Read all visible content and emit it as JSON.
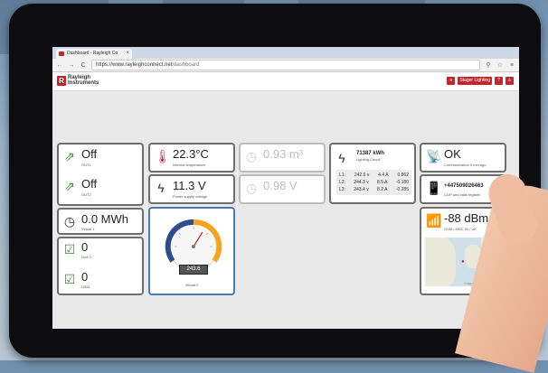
{
  "browser": {
    "tab_title": "Dashboard - Rayleigh Co",
    "tab_close": "×",
    "url_prefix": "https://www.rayleighconnect.net",
    "url_path": "/dashboard"
  },
  "header": {
    "logo_mark": "R",
    "logo_line1": "Rayleigh",
    "logo_line2": "Instruments",
    "buttons": [
      "≡",
      "Stager Lighting",
      "?",
      "⚠"
    ]
  },
  "tiles": {
    "out1": {
      "value": "Off",
      "label": "OUT1"
    },
    "out2": {
      "value": "Off",
      "label": "OUT2"
    },
    "temp": {
      "value": "22.3°C",
      "label": "Internal temperature"
    },
    "voltage": {
      "value": "11.3 V",
      "label": "Power supply voltage"
    },
    "flow": {
      "value": "0.93 m³",
      "label": ""
    },
    "volt2": {
      "value": "0.98 V",
      "label": ""
    },
    "virtual1": {
      "value": "0.0 MWh",
      "label": "Virtual 1"
    },
    "line2": {
      "value": "0",
      "label": "Line 2"
    },
    "din3": {
      "value": "0",
      "label": "DIN3"
    },
    "comm": {
      "value": "OK",
      "label": "Communication 5 min ago"
    },
    "phone": {
      "value": "+447509026463",
      "label": "CLIP and calls register"
    },
    "signal": {
      "value": "-88 dBm",
      "label": "GSM / MNC 50 / UK"
    }
  },
  "energy": {
    "value": "71387 kWh",
    "label": "Lighting Circuit",
    "rows": [
      {
        "line": "L1:",
        "volts": "242.6 v",
        "amps": "4.4 A",
        "pf": "0.862"
      },
      {
        "line": "L2:",
        "volts": "244.3 v",
        "amps": "8.5 A",
        "pf": "-0.180"
      },
      {
        "line": "L3:",
        "volts": "243.4 v",
        "amps": "8.2 A",
        "pf": "-0.285"
      }
    ]
  },
  "gauge": {
    "reading": "243.6",
    "label": "Virtual 2",
    "blue": "#2d4d8e",
    "orange": "#f2a620"
  },
  "map": {
    "copyright": "© OpenStreetMap contributors"
  },
  "colors": {
    "accent": "#c0272d",
    "tile_border": "#6e6e6e",
    "gauge_border": "#4a79b8"
  }
}
